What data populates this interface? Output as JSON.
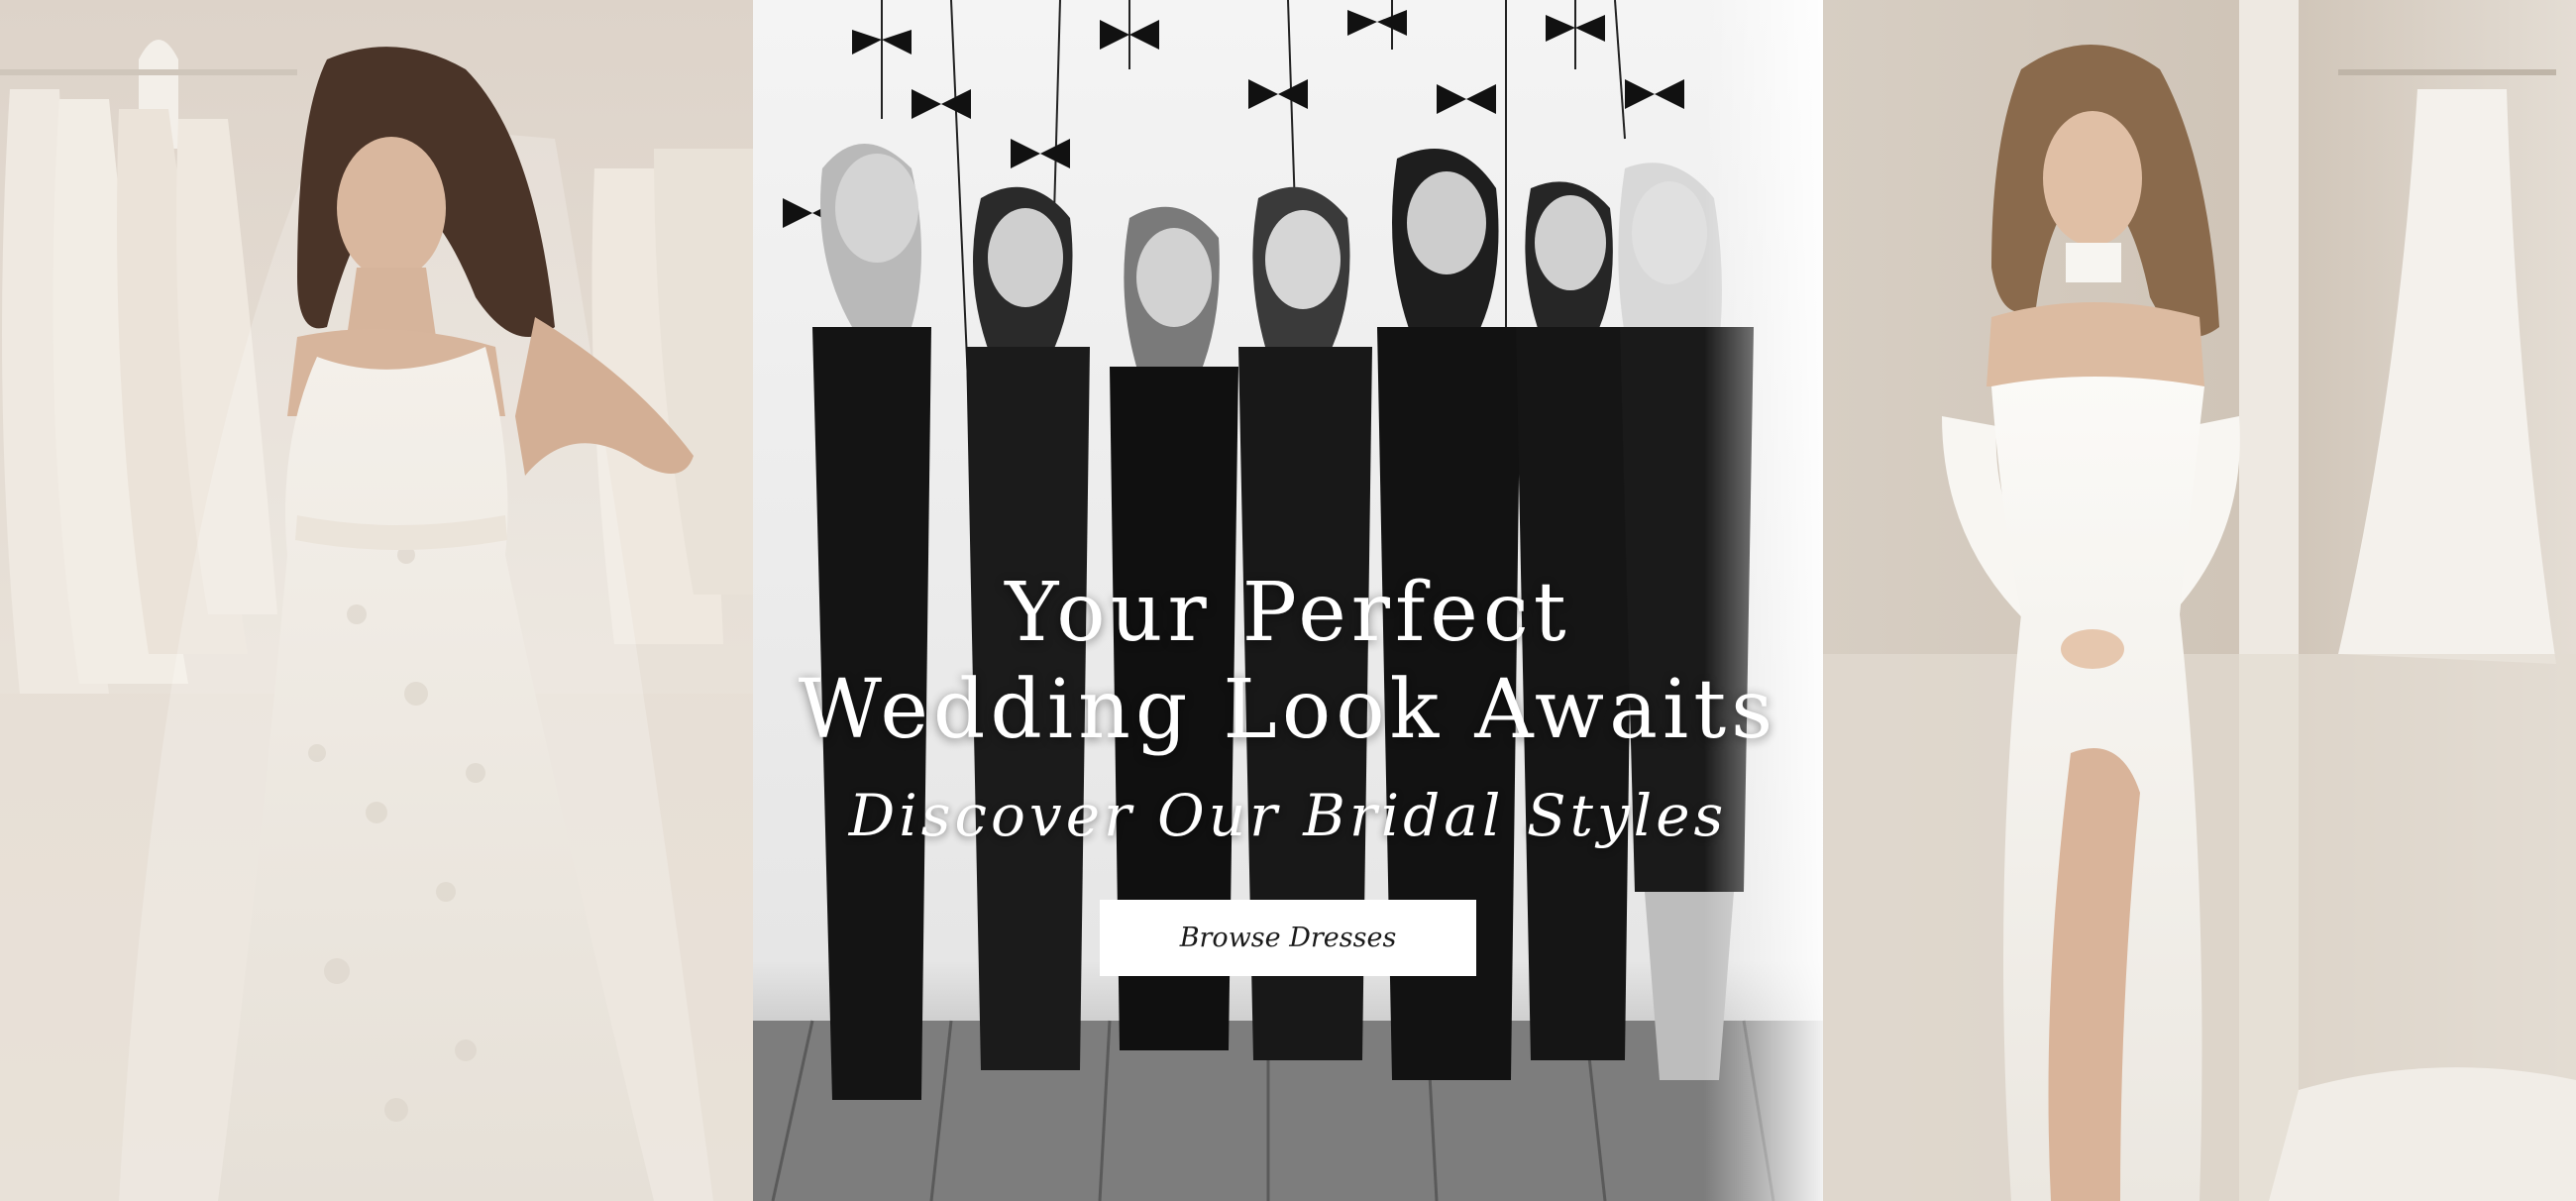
{
  "hero": {
    "headline_line1": "Your Perfect",
    "headline_line2": "Wedding Look Awaits",
    "subheadline": "Discover Our Bridal Styles",
    "cta_label": "Browse Dresses"
  },
  "images": {
    "left": "bride-lace-gown-photo",
    "center": "bridesmaids-group-bw-photo",
    "right": "bride-satin-gown-photo"
  },
  "colors": {
    "text": "#ffffff",
    "button_bg": "#ffffff",
    "button_text": "#1a1a1a"
  }
}
